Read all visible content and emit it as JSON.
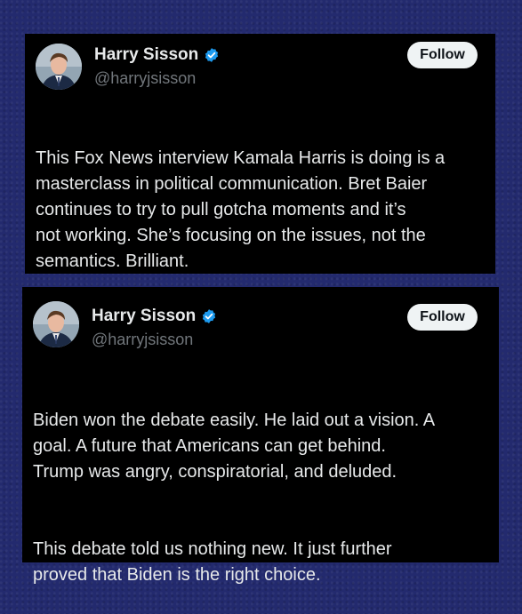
{
  "tweets": [
    {
      "name": "Harry Sisson",
      "handle": "@harryjsisson",
      "follow_label": "Follow",
      "paragraphs": [
        "This Fox News interview Kamala Harris is doing is a\nmasterclass in political communication. Bret Baier\ncontinues to try to pull gotcha moments and it’s\nnot working. She’s focusing on the issues, not the\nsemantics. Brilliant."
      ]
    },
    {
      "name": "Harry Sisson",
      "handle": "@harryjsisson",
      "follow_label": "Follow",
      "paragraphs": [
        "Biden won the debate easily. He laid out a vision. A\ngoal. A future that Americans can get behind.\nTrump was angry, conspiratorial, and deluded.",
        "This debate told us nothing new. It just further\nproved that Biden is the right choice."
      ]
    }
  ],
  "colors": {
    "background": "#232a6e",
    "card": "#000000",
    "text": "#e7e9ea",
    "handle": "#71767b",
    "verified": "#1d9bf0",
    "follow_button": "#eff3f4"
  },
  "icons": {
    "verified": "verified-badge-icon",
    "avatar": "profile-photo"
  }
}
